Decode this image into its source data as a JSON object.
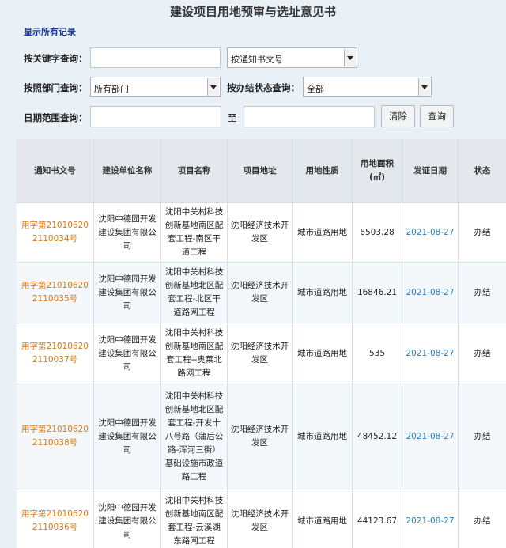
{
  "page": {
    "title": "建设项目用地预审与选址意见书",
    "show_all": "显示所有记录"
  },
  "filters": {
    "keyword_label": "按关键字查询：",
    "keyword_value": "",
    "keyword_type": "按通知书文号",
    "dept_label": "按照部门查询：",
    "dept_value": "所有部门",
    "status_label": "按办结状态查询：",
    "status_value": "全部",
    "date_label": "日期范围查询：",
    "date_to": "至",
    "date_from_value": "",
    "date_to_value": "",
    "clear_button": "清除",
    "search_button": "查询"
  },
  "table": {
    "headers": [
      "通知书文号",
      "建设单位名称",
      "项目名称",
      "项目地址",
      "用地性质",
      "用地面积(㎡)",
      "发证日期",
      "状态"
    ],
    "rows": [
      {
        "doc_no": "用字第210106202110034号",
        "unit": "沈阳中德园开发建设集团有限公司",
        "project": "沈阳中关村科技创新基地南区配套工程-南区干道工程",
        "address": "沈阳经济技术开发区",
        "nature": "城市道路用地",
        "area": "6503.28",
        "date": "2021-08-27",
        "status": "办结"
      },
      {
        "doc_no": "用字第210106202110035号",
        "unit": "沈阳中德园开发建设集团有限公司",
        "project": "沈阳中关村科技创新基地北区配套工程-北区干道路网工程",
        "address": "沈阳经济技术开发区",
        "nature": "城市道路用地",
        "area": "16846.21",
        "date": "2021-08-27",
        "status": "办结"
      },
      {
        "doc_no": "用字第210106202110037号",
        "unit": "沈阳中德园开发建设集团有限公司",
        "project": "沈阳中关村科技创新基地南区配套工程--奥莱北路网工程",
        "address": "沈阳经济技术开发区",
        "nature": "城市道路用地",
        "area": "535",
        "date": "2021-08-27",
        "status": "办结"
      },
      {
        "doc_no": "用字第210106202110038号",
        "unit": "沈阳中德园开发建设集团有限公司",
        "project": "沈阳中关村科技创新基地北区配套工程-开发十八号路（蒲后公路-浑河三街）基础设施市政道路工程",
        "address": "沈阳经济技术开发区",
        "nature": "城市道路用地",
        "area": "48452.12",
        "date": "2021-08-27",
        "status": "办结"
      },
      {
        "doc_no": "用字第210106202110036号",
        "unit": "沈阳中德园开发建设集团有限公司",
        "project": "沈阳中关村科技创新基地南区配套工程-云溪湖东路网工程",
        "address": "沈阳经济技术开发区",
        "nature": "城市道路用地",
        "area": "44123.67",
        "date": "2021-08-27",
        "status": "办结"
      }
    ]
  }
}
